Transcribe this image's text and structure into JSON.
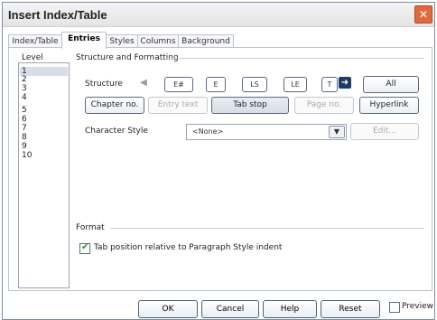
{
  "window": {
    "title": "Insert Index/Table",
    "close_label": "✕"
  },
  "tabs": [
    {
      "label": "Index/Table"
    },
    {
      "label": "Entries"
    },
    {
      "label": "Styles"
    },
    {
      "label": "Columns"
    },
    {
      "label": "Background"
    }
  ],
  "left": {
    "header": "Level",
    "levels": [
      "1",
      "2",
      "3",
      "4",
      "5",
      "6",
      "7",
      "8",
      "9",
      "10"
    ]
  },
  "structure": {
    "group_title": "Structure and Formatting",
    "label": "Structure",
    "tokens": [
      "E#",
      "E",
      "LS",
      "LE",
      "T"
    ],
    "all_button": "All"
  },
  "buttons": {
    "chapter_no": "Chapter no.",
    "entry_text": "Entry text",
    "tab_stop": "Tab stop",
    "page_no": "Page no.",
    "hyperlink": "Hyperlink"
  },
  "character_style": {
    "label": "Character Style",
    "value": "<None>",
    "edit": "Edit..."
  },
  "format": {
    "group_title": "Format",
    "checkbox_label": "Tab position relative to Paragraph Style indent"
  },
  "bottom": {
    "ok": "OK",
    "cancel": "Cancel",
    "help": "Help",
    "reset": "Reset",
    "preview": "Preview"
  }
}
